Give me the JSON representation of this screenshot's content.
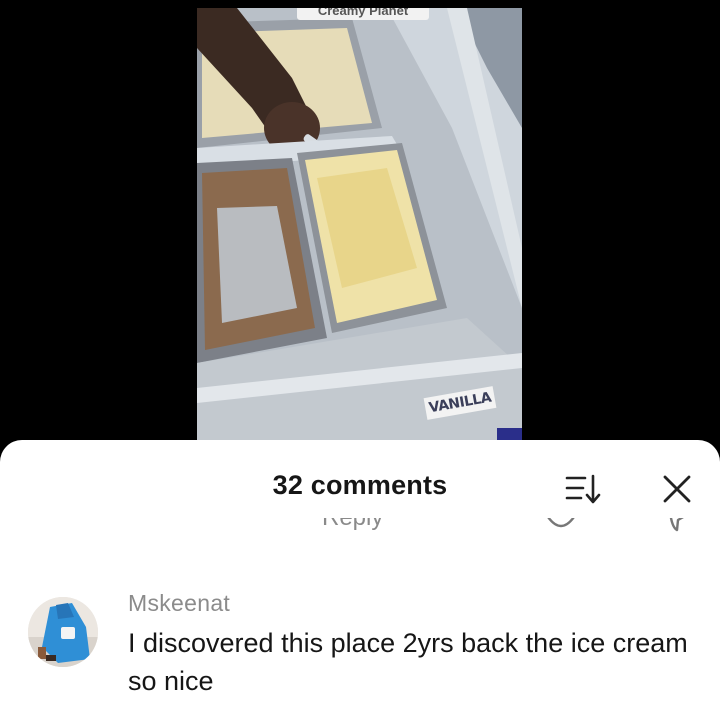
{
  "video": {
    "store_sign": "Creamy Planet",
    "flavor_label": "VANILLA"
  },
  "comments_sheet": {
    "title": "32 comments",
    "sort_icon": "sort-descending-icon",
    "close_icon": "close-icon",
    "hidden_row": {
      "reply_label": "Reply",
      "like_icon": "heart-icon",
      "dislike_icon": "thumbs-down-icon"
    },
    "comments": [
      {
        "author": "Mskeenat",
        "text": "I discovered this place 2yrs back the ice cream so nice"
      }
    ]
  }
}
